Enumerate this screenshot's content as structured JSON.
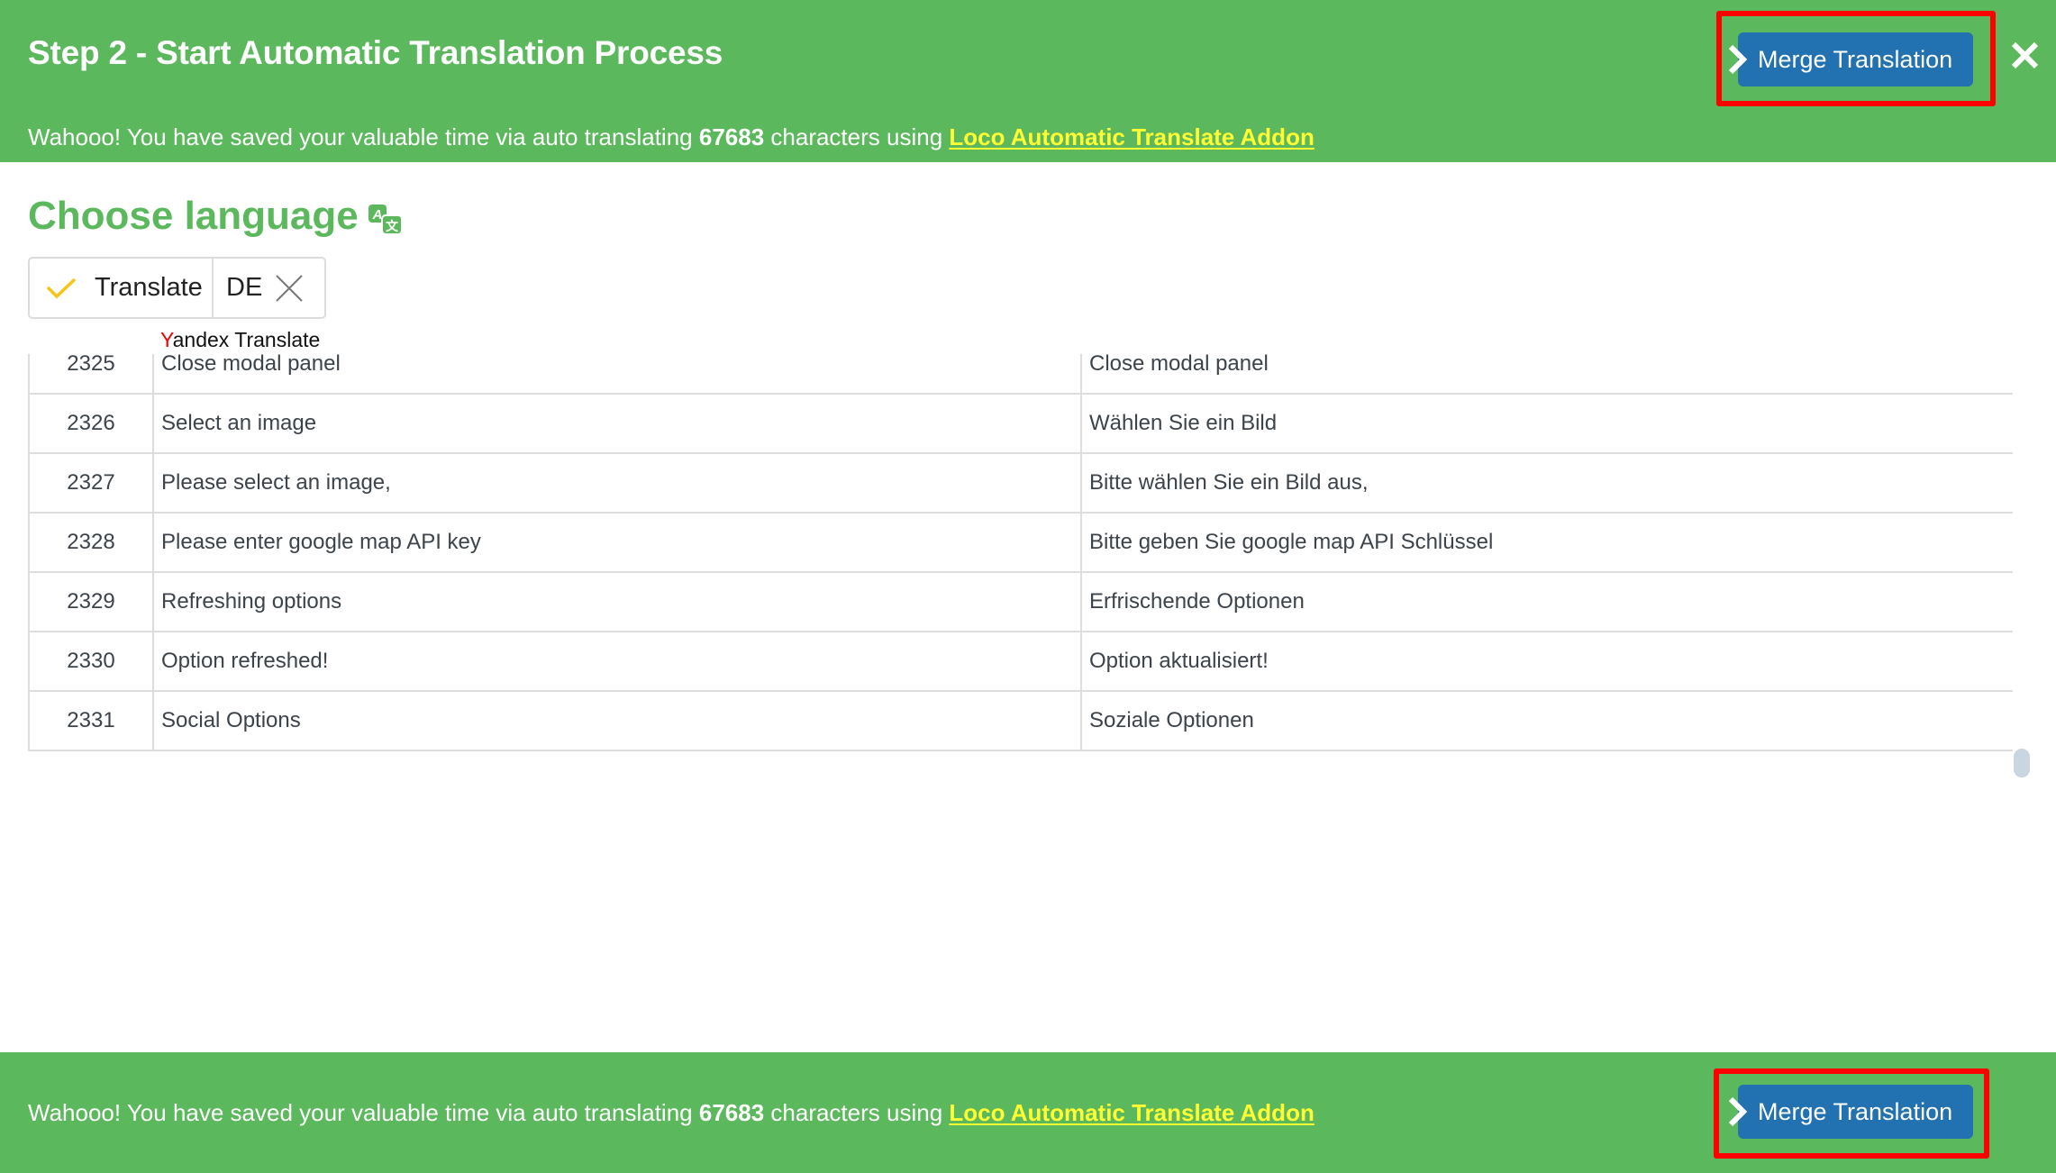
{
  "header": {
    "title": "Step 2 - Start Automatic Translation Process",
    "merge_label": "Merge Translation",
    "close_icon": "close-icon"
  },
  "savings": {
    "prefix": "Wahooo! You have saved your valuable time via auto translating ",
    "count": "67683",
    "middle": " characters using ",
    "link": "Loco Automatic Translate Addon"
  },
  "choose": {
    "title": "Choose language",
    "icon": "translate-language-icon"
  },
  "widget": {
    "translate_label": "Translate",
    "language": "DE",
    "provider_first": "Y",
    "provider_rest": "andex Translate"
  },
  "table": {
    "rows": [
      {
        "num": "2325",
        "source": "Close modal panel",
        "target": "Close modal panel"
      },
      {
        "num": "2326",
        "source": "Select an image",
        "target": "Wählen Sie ein Bild"
      },
      {
        "num": "2327",
        "source": "Please select an image,",
        "target": "Bitte wählen Sie ein Bild aus,"
      },
      {
        "num": "2328",
        "source": "Please enter google map API key",
        "target": "Bitte geben Sie google map API Schlüssel"
      },
      {
        "num": "2329",
        "source": "Refreshing options",
        "target": "Erfrischende Optionen"
      },
      {
        "num": "2330",
        "source": "Option refreshed!",
        "target": "Option aktualisiert!"
      },
      {
        "num": "2331",
        "source": "Social Options",
        "target": "Soziale Optionen"
      }
    ]
  },
  "footer": {
    "merge_label": "Merge Translation"
  },
  "colors": {
    "brand_green": "#5cb85c",
    "button_blue": "#2271b1",
    "link_yellow": "#ffff33",
    "highlight_red": "#ff0000",
    "check_yellow": "#f5c518"
  }
}
